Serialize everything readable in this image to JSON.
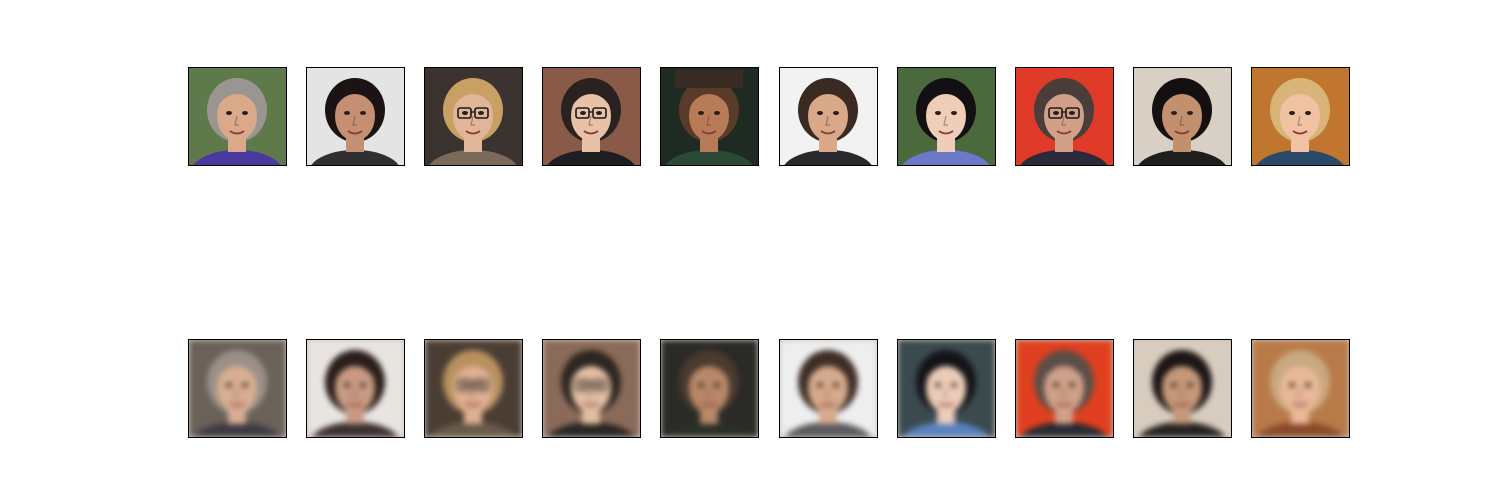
{
  "figure": {
    "rows": [
      {
        "name": "original-row",
        "tiles": [
          {
            "bg": "#5f7a4a",
            "skin": "#d9a98a",
            "hair": "#9a9590",
            "cloth": "#4a3aa0",
            "glasses": false,
            "cap": false
          },
          {
            "bg": "#e4e4e4",
            "skin": "#c48f73",
            "hair": "#1c1414",
            "cloth": "#303030",
            "glasses": false,
            "cap": false
          },
          {
            "bg": "#3a3330",
            "skin": "#e0b598",
            "hair": "#c9a064",
            "cloth": "#7a6a5a",
            "glasses": true,
            "cap": false
          },
          {
            "bg": "#8a5a48",
            "skin": "#e8c2a6",
            "hair": "#2a2220",
            "cloth": "#1e1e22",
            "glasses": true,
            "cap": false
          },
          {
            "bg": "#1e2a22",
            "skin": "#b77b58",
            "hair": "#5a3a28",
            "cloth": "#2b4a36",
            "glasses": false,
            "cap": true
          },
          {
            "bg": "#f2f2f2",
            "skin": "#d8a888",
            "hair": "#3a2a22",
            "cloth": "#2a2a2e",
            "glasses": false,
            "cap": false
          },
          {
            "bg": "#4a6a3e",
            "skin": "#f0cdb8",
            "hair": "#121012",
            "cloth": "#6a7ac8",
            "glasses": false,
            "cap": false
          },
          {
            "bg": "#e03a28",
            "skin": "#d2a088",
            "hair": "#4a3e3a",
            "cloth": "#2a2a3a",
            "glasses": true,
            "cap": false
          },
          {
            "bg": "#d8d0c4",
            "skin": "#c2906c",
            "hair": "#141010",
            "cloth": "#1e1e1e",
            "glasses": false,
            "cap": false
          },
          {
            "bg": "#c0762e",
            "skin": "#f0c2a2",
            "hair": "#d8b478",
            "cloth": "#2a4a6a",
            "glasses": false,
            "cap": false
          }
        ]
      },
      {
        "name": "reconstruction-row",
        "tiles": [
          {
            "bg": "#6a6258",
            "skin": "#d8ae92",
            "hair": "#9a9088",
            "cloth": "#3e3a44",
            "glasses": false,
            "cap": false
          },
          {
            "bg": "#e8e4e0",
            "skin": "#c89a82",
            "hair": "#2a1e1c",
            "cloth": "#3a3030",
            "glasses": false,
            "cap": false
          },
          {
            "bg": "#4a3e34",
            "skin": "#dcb092",
            "hair": "#b89060",
            "cloth": "#6a5a4a",
            "glasses": true,
            "cap": false
          },
          {
            "bg": "#8a6a58",
            "skin": "#e2bea2",
            "hair": "#2e2622",
            "cloth": "#2a2624",
            "glasses": true,
            "cap": false
          },
          {
            "bg": "#2a2a26",
            "skin": "#b88868",
            "hair": "#4a3a30",
            "cloth": "#2a3028",
            "glasses": false,
            "cap": false
          },
          {
            "bg": "#eeeeee",
            "skin": "#d6aa8c",
            "hair": "#3e2e26",
            "cloth": "#5a5a5e",
            "glasses": false,
            "cap": false
          },
          {
            "bg": "#3a4a4e",
            "skin": "#ecccb8",
            "hair": "#141418",
            "cloth": "#5a82c0",
            "glasses": false,
            "cap": false
          },
          {
            "bg": "#e04020",
            "skin": "#d0a088",
            "hair": "#5a4e48",
            "cloth": "#2a2a32",
            "glasses": false,
            "cap": false
          },
          {
            "bg": "#d8ccbe",
            "skin": "#c6987a",
            "hair": "#1c1616",
            "cloth": "#262222",
            "glasses": false,
            "cap": false
          },
          {
            "bg": "#b87a48",
            "skin": "#e8b898",
            "hair": "#c8a880",
            "cloth": "#8a4a2a",
            "glasses": false,
            "cap": false
          }
        ]
      }
    ]
  }
}
